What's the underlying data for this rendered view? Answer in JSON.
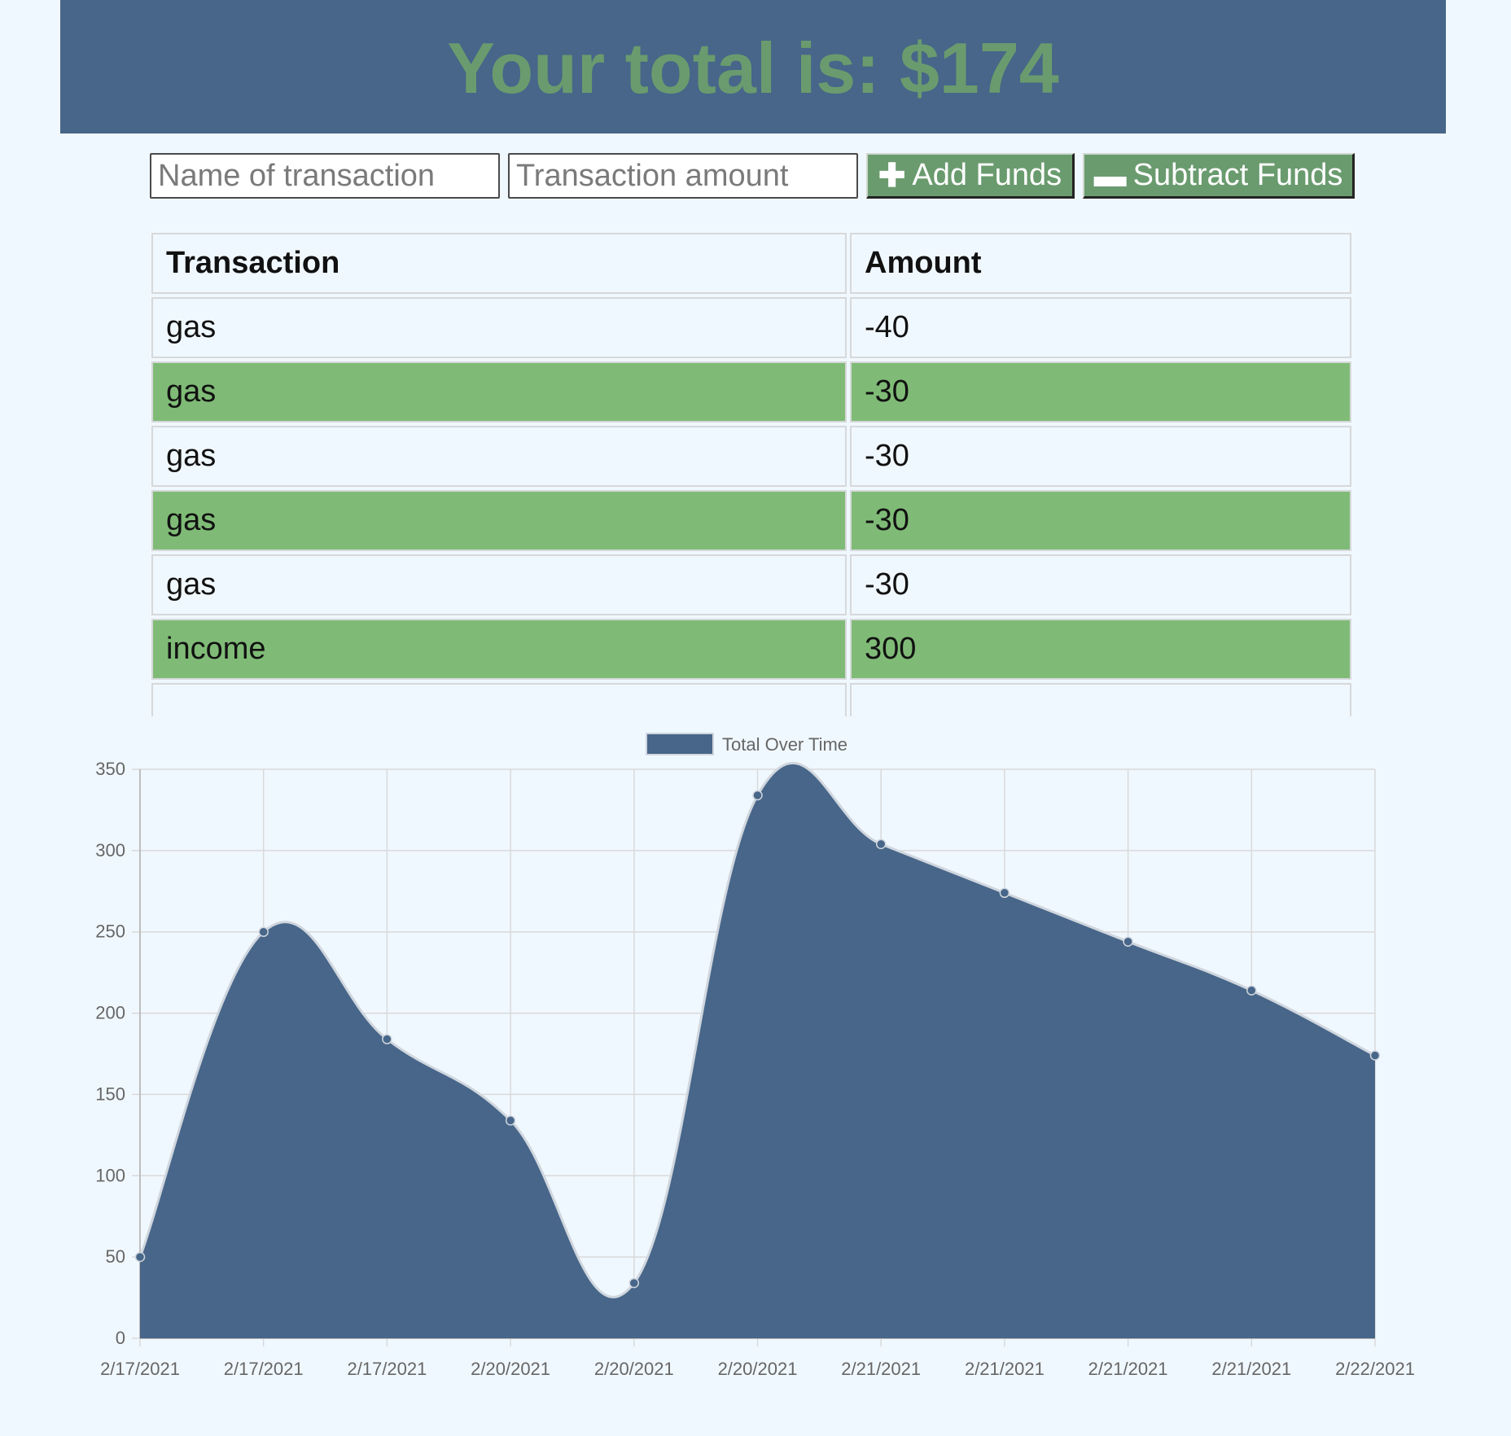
{
  "header": {
    "title": "Your total is: $174"
  },
  "form": {
    "name_placeholder": "Name of transaction",
    "amount_placeholder": "Transaction amount",
    "add_label": "Add Funds",
    "subtract_label": "Subtract Funds",
    "add_icon": "plus-icon",
    "subtract_icon": "minus-icon"
  },
  "table": {
    "headers": [
      "Transaction",
      "Amount"
    ],
    "rows": [
      {
        "name": "gas",
        "amount": "-40"
      },
      {
        "name": "gas",
        "amount": "-30"
      },
      {
        "name": "gas",
        "amount": "-30"
      },
      {
        "name": "gas",
        "amount": "-30"
      },
      {
        "name": "gas",
        "amount": "-30"
      },
      {
        "name": "income",
        "amount": "300"
      }
    ]
  },
  "colors": {
    "header_bg": "#476689",
    "accent_green": "#6a9b6e",
    "row_highlight": "#7fbb76",
    "page_bg": "#f0f8ff",
    "chart_fill": "#476689"
  },
  "chart_data": {
    "type": "area",
    "legend": [
      "Total Over Time"
    ],
    "legend_position": "top",
    "grid": true,
    "categories": [
      "2/17/2021",
      "2/17/2021",
      "2/17/2021",
      "2/20/2021",
      "2/20/2021",
      "2/20/2021",
      "2/21/2021",
      "2/21/2021",
      "2/21/2021",
      "2/21/2021",
      "2/22/2021"
    ],
    "series": [
      {
        "name": "Total Over Time",
        "values": [
          50,
          250,
          184,
          134,
          34,
          334,
          304,
          274,
          244,
          214,
          174
        ]
      }
    ],
    "ylim": [
      0,
      350
    ],
    "yticks": [
      0,
      50,
      100,
      150,
      200,
      250,
      300,
      350
    ]
  }
}
